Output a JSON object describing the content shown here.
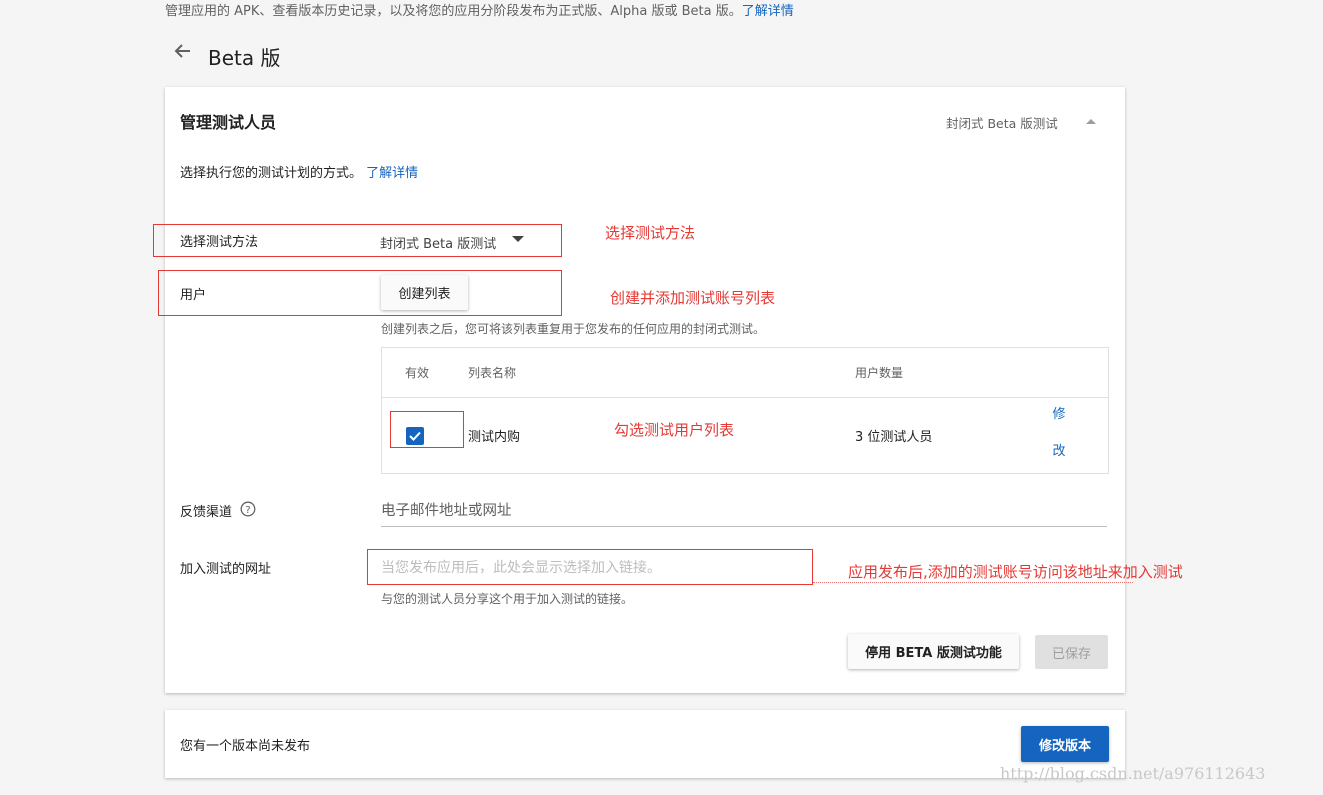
{
  "header": {
    "description": "管理应用的 APK、查看版本历史记录，以及将您的应用分阶段发布为正式版、Alpha 版或 Beta 版。",
    "learn_more": "了解详情",
    "page_title": "Beta 版"
  },
  "manage_testers": {
    "title": "管理测试人员",
    "testing_type": "封闭式 Beta 版测试",
    "intro": "选择执行您的测试计划的方式。",
    "intro_link": "了解详情",
    "method_label": "选择测试方法",
    "method_value": "封闭式 Beta 版测试",
    "users_label": "用户",
    "create_list_button": "创建列表",
    "create_list_hint": "创建列表之后，您可将该列表重复用于您发布的任何应用的封闭式测试。",
    "table": {
      "headers": [
        "有效",
        "列表名称",
        "用户数量"
      ],
      "rows": [
        {
          "checked": true,
          "name": "测试内购",
          "count": "3 位测试人员",
          "action_1": "修",
          "action_2": "改"
        }
      ]
    },
    "feedback_label": "反馈渠道",
    "feedback_placeholder": "电子邮件地址或网址",
    "join_url_label": "加入测试的网址",
    "join_url_placeholder": "当您发布应用后，此处会显示选择加入链接。",
    "join_url_hint": "与您的测试人员分享这个用于加入测试的链接。",
    "disable_button": "停用 BETA 版测试功能",
    "saved_button": "已保存"
  },
  "release": {
    "unpublished_text": "您有一个版本尚未发布",
    "edit_button": "修改版本"
  },
  "annotations": {
    "choose_method": "选择测试方法",
    "create_list": "创建并添加测试账号列表",
    "check_list": "勾选测试用户列表",
    "join_url_note": "应用发布后,添加的测试账号访问该地址来加入测试"
  },
  "watermark": "http://blog.csdn.net/a976112643",
  "colors": {
    "accent": "#1565c0",
    "annotation_red": "#e53935",
    "background": "#f5f5f5"
  },
  "icons": {
    "back": "arrow-left",
    "collapse": "triangle-up",
    "dropdown": "caret-down",
    "checkbox": "checkmark",
    "help": "question-circle"
  }
}
